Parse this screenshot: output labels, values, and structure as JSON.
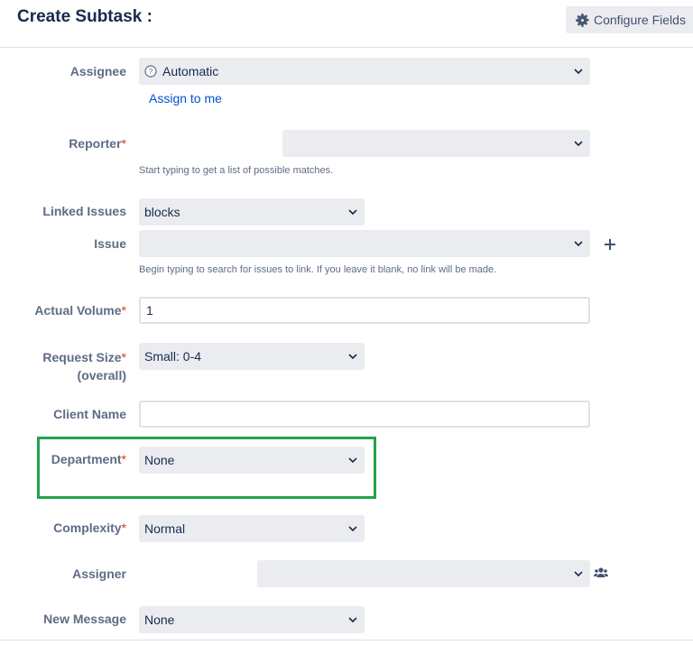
{
  "dialog": {
    "title": "Create Subtask :",
    "configure_label": "Configure Fields"
  },
  "fields": {
    "assignee": {
      "label": "Assignee",
      "value": "Automatic",
      "assign_to_me": "Assign to me"
    },
    "reporter": {
      "label": "Reporter",
      "required": "*",
      "value": "",
      "hint": "Start typing to get a list of possible matches."
    },
    "linked_issues": {
      "label": "Linked Issues",
      "value": "blocks"
    },
    "issue": {
      "label": "Issue",
      "value": "",
      "hint": "Begin typing to search for issues to link. If you leave it blank, no link will be made."
    },
    "actual_volume": {
      "label": "Actual Volume",
      "required": "*",
      "value": "1"
    },
    "request_size": {
      "label_line1": "Request Size",
      "label_line2": "(overall)",
      "required": "*",
      "value": "Small: 0-4"
    },
    "client_name": {
      "label": "Client Name",
      "value": ""
    },
    "department": {
      "label": "Department",
      "required": "*",
      "value": "None"
    },
    "complexity": {
      "label": "Complexity",
      "required": "*",
      "value": "Normal"
    },
    "assigner": {
      "label": "Assigner",
      "value": ""
    },
    "new_message": {
      "label": "New Message",
      "value": "None"
    }
  },
  "icons": {
    "configure": "gear-icon",
    "assignee_avatar": "user-avatar-icon",
    "add_issue": "plus-icon",
    "assigner_group": "users-group-icon",
    "dropdown": "chevron-down-icon"
  },
  "colors": {
    "highlight_border": "#21a34a",
    "link": "#0052cc",
    "required": "#de350b"
  }
}
